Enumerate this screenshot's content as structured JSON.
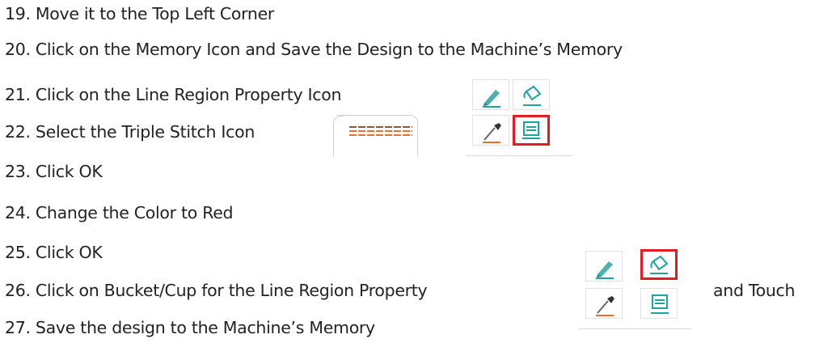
{
  "steps": [
    "19. Move it to the Top Left Corner",
    "20. Click on the Memory Icon and Save the Design to the Machine’s Memory",
    "21. Click on the Line Region Property Icon",
    "22. Select the Triple Stitch Icon",
    "23.  Click OK",
    "24. Change the Color to Red",
    "25. Click OK",
    "26. Click on Bucket/Cup for the Line Region Property",
    "27. Save the design to the Machine’s Memory"
  ],
  "step26_suffix": "and Touch",
  "icon_grid_1": {
    "icons": [
      "pen-icon",
      "bucket-icon",
      "eyedropper-icon",
      "line-region-property-icon"
    ],
    "selected": "line-region-property-icon"
  },
  "icon_grid_2": {
    "icons": [
      "pen-icon",
      "bucket-icon",
      "eyedropper-icon",
      "line-region-property-icon"
    ],
    "selected": "bucket-icon"
  },
  "colors": {
    "accent": "#1aa5a0",
    "highlight": "#e21c22",
    "stitch": "#e8722a"
  }
}
